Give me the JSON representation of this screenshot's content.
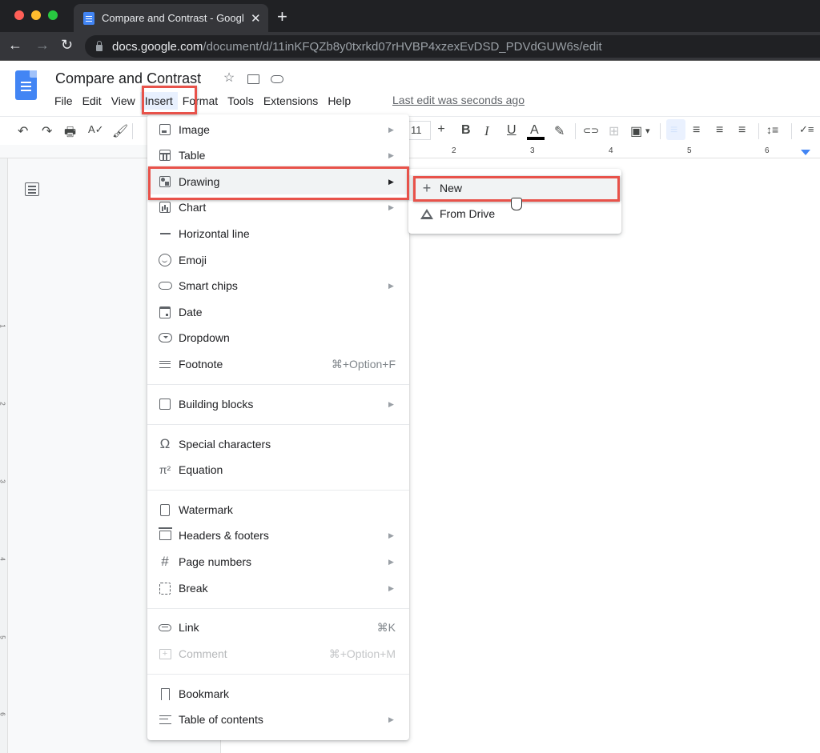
{
  "browser": {
    "tab_title": "Compare and Contrast - Googl",
    "tab_close": "✕",
    "new_tab": "+",
    "back": "←",
    "forward": "→",
    "reload": "↻",
    "url_host": "docs.google.com",
    "url_path": "/document/d/11inKFQZb8y0txrkd07rHVBP4xzexEvDSD_PDVdGUW6s/edit"
  },
  "doc": {
    "title": "Compare and Contrast",
    "star": "☆",
    "last_edit": "Last edit was seconds ago",
    "menus": [
      "File",
      "Edit",
      "View",
      "Insert",
      "Format",
      "Tools",
      "Extensions",
      "Help"
    ],
    "active_menu": "Insert"
  },
  "toolbar": {
    "undo": "↶",
    "redo": "↷",
    "print": "🖶",
    "spellcheck": "A✓",
    "paint_format": "🖌",
    "font_size": "11",
    "font_size_plus": "+",
    "bold": "B",
    "italic": "I",
    "underline": "U",
    "text_color": "A",
    "highlight": "✎",
    "link": "⊂⊃",
    "comment": "⊞",
    "image": "▣",
    "image_caret": "▾",
    "align_left": "≡",
    "align_center": "≡",
    "align_right": "≡",
    "justify": "≡",
    "line_spacing": "↕≡",
    "checklist": "✓≡"
  },
  "ruler": {
    "h_numbers": [
      "2",
      "3",
      "4",
      "5",
      "6"
    ],
    "v_numbers": [
      "1",
      "2",
      "3",
      "4",
      "5",
      "6"
    ]
  },
  "insert_menu": {
    "items": [
      {
        "label": "Image",
        "icon": "image-icon",
        "submenu": true
      },
      {
        "label": "Table",
        "icon": "table-icon",
        "submenu": true
      },
      {
        "label": "Drawing",
        "icon": "drawing-icon",
        "submenu": true,
        "highlighted": true
      },
      {
        "label": "Chart",
        "icon": "chart-icon",
        "submenu": true
      },
      {
        "label": "Horizontal line",
        "icon": "horizontal-line-icon"
      },
      {
        "label": "Emoji",
        "icon": "emoji-icon"
      },
      {
        "label": "Smart chips",
        "icon": "smart-chips-icon",
        "submenu": true
      },
      {
        "label": "Date",
        "icon": "date-icon"
      },
      {
        "label": "Dropdown",
        "icon": "dropdown-icon"
      },
      {
        "label": "Footnote",
        "icon": "footnote-icon",
        "shortcut": "⌘+Option+F"
      },
      {
        "label": "Building blocks",
        "icon": "building-blocks-icon",
        "submenu": true
      },
      {
        "label": "Special characters",
        "icon": "omega-icon",
        "glyph": "Ω"
      },
      {
        "label": "Equation",
        "icon": "pi-icon",
        "glyph": "π²"
      },
      {
        "label": "Watermark",
        "icon": "watermark-icon"
      },
      {
        "label": "Headers & footers",
        "icon": "headers-footers-icon",
        "submenu": true
      },
      {
        "label": "Page numbers",
        "icon": "hash-icon",
        "submenu": true,
        "glyph": "#"
      },
      {
        "label": "Break",
        "icon": "break-icon",
        "submenu": true
      },
      {
        "label": "Link",
        "icon": "link-icon",
        "shortcut": "⌘K"
      },
      {
        "label": "Comment",
        "icon": "comment-icon",
        "shortcut": "⌘+Option+M",
        "disabled": true
      },
      {
        "label": "Bookmark",
        "icon": "bookmark-icon"
      },
      {
        "label": "Table of contents",
        "icon": "toc-icon",
        "submenu": true
      }
    ],
    "arrow": "▶"
  },
  "drawing_submenu": {
    "items": [
      {
        "label": "New",
        "glyph": "+",
        "highlighted": true
      },
      {
        "label": "From Drive"
      }
    ]
  },
  "colors": {
    "highlight_box": "#e8524a",
    "docs_blue": "#4285f4",
    "menu_hover": "#f1f3f4"
  }
}
